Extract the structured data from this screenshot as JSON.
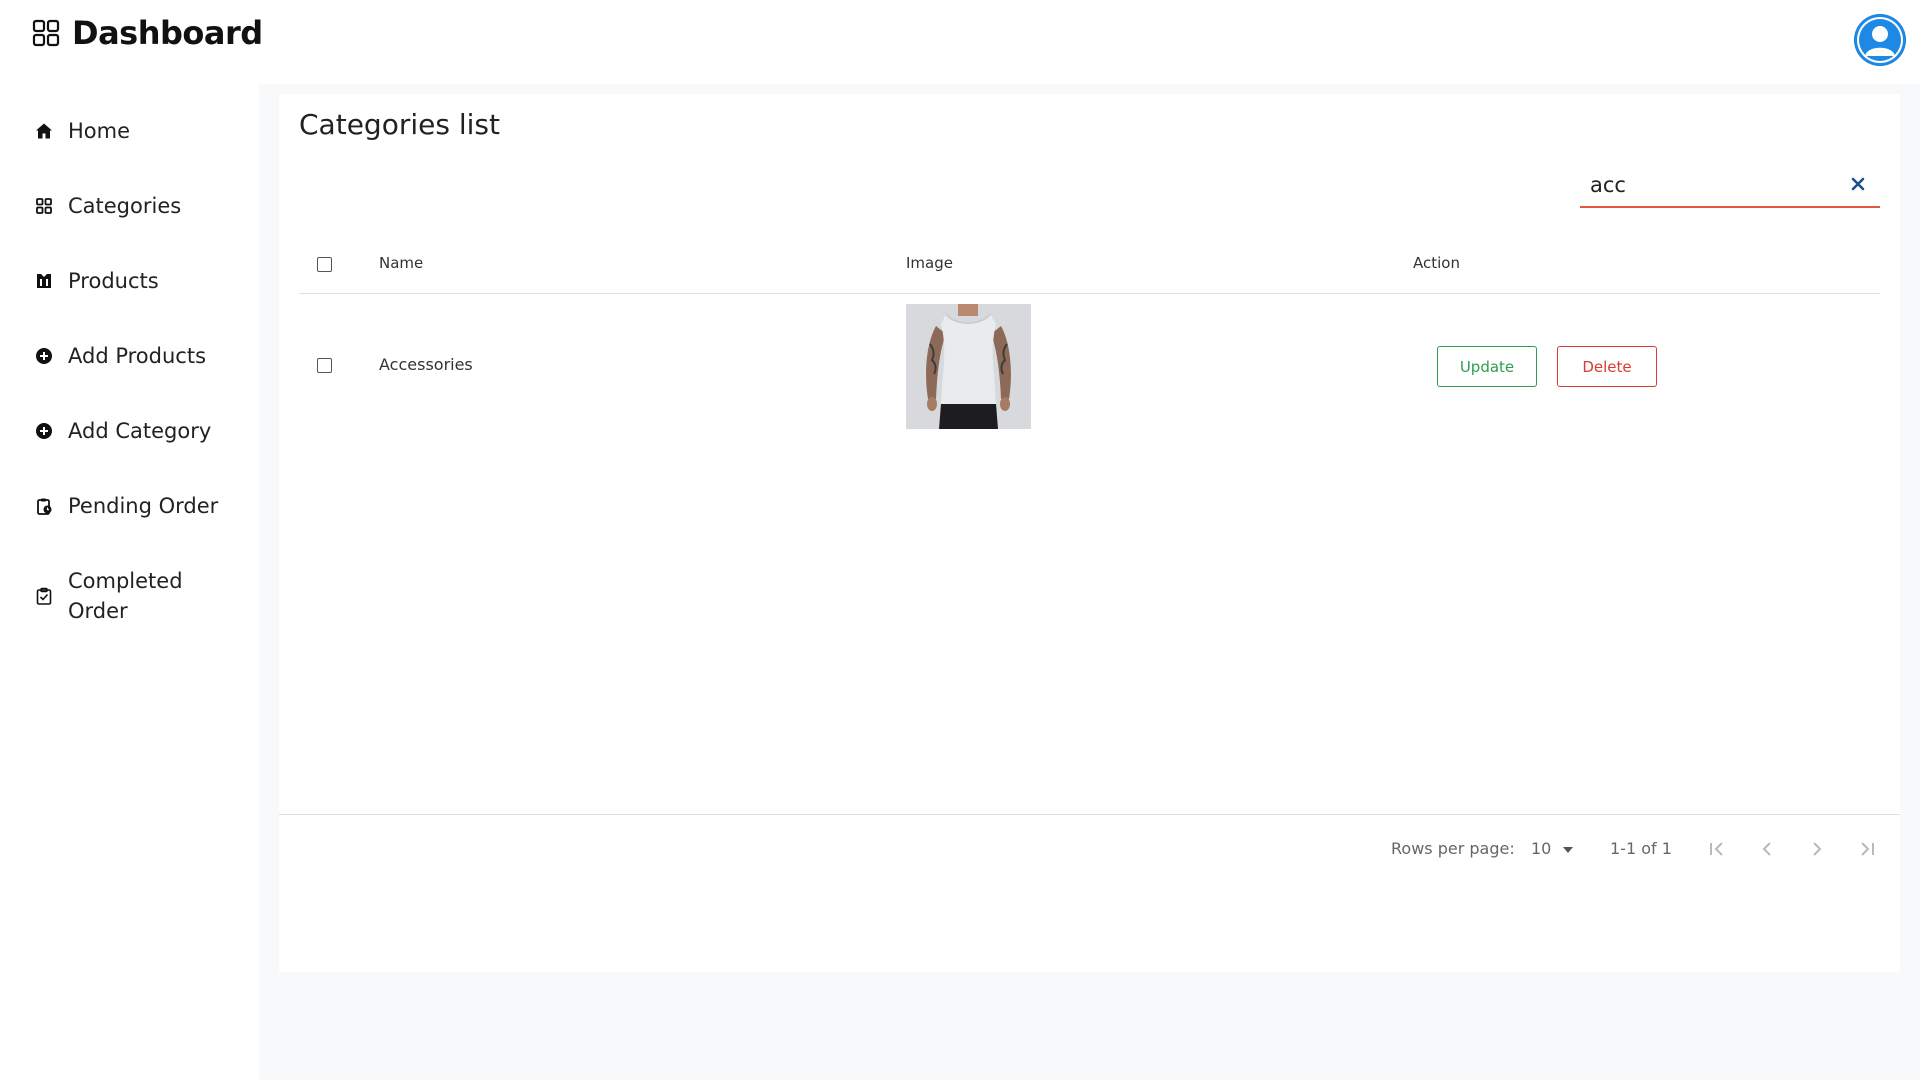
{
  "app": {
    "title": "Dashboard"
  },
  "sidebar": {
    "items": [
      {
        "label": "Home",
        "icon": "home-icon"
      },
      {
        "label": "Categories",
        "icon": "grid-icon"
      },
      {
        "label": "Products",
        "icon": "products-icon"
      },
      {
        "label": "Add Products",
        "icon": "plus-circle-icon"
      },
      {
        "label": "Add Category",
        "icon": "plus-circle-icon"
      },
      {
        "label": "Pending Order",
        "icon": "clipboard-clock-icon"
      },
      {
        "label": "Completed Order",
        "icon": "clipboard-check-icon"
      }
    ]
  },
  "main": {
    "title": "Categories list",
    "search": {
      "value": "acc",
      "placeholder": ""
    },
    "table": {
      "columns": [
        "Name",
        "Image",
        "Action"
      ],
      "rows": [
        {
          "name": "Accessories",
          "image": "tank-top-photo",
          "update_label": "Update",
          "delete_label": "Delete"
        }
      ]
    },
    "pagination": {
      "rows_per_page_label": "Rows per page:",
      "rows_per_page": "10",
      "range": "1-1 of 1"
    }
  },
  "colors": {
    "accent": "#e2583e",
    "update": "#2e9e4e",
    "delete": "#d93a31",
    "avatar": "#1e88e5"
  }
}
